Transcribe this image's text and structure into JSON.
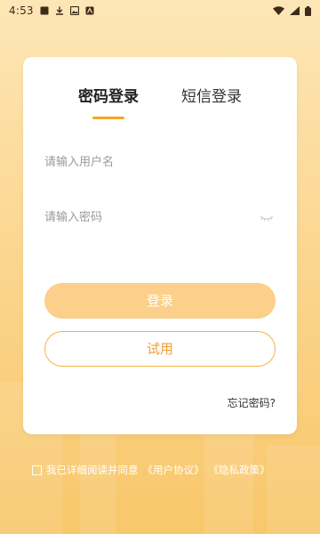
{
  "status_bar": {
    "time": "4:53",
    "icons": [
      "notification-square-icon",
      "download-icon",
      "photo-icon",
      "app-icon"
    ],
    "right_icons": [
      "wifi-icon",
      "signal-icon",
      "battery-icon"
    ]
  },
  "login": {
    "tabs": [
      {
        "label": "密码登录",
        "active": true
      },
      {
        "label": "短信登录",
        "active": false
      }
    ],
    "username_placeholder": "请输入用户名",
    "password_placeholder": "请输入密码",
    "login_button": "登录",
    "trial_button": "试用",
    "forgot_password": "忘记密码?"
  },
  "agreement": {
    "prefix": "我已详细阅读并同意",
    "user_agreement": "《用户协议》",
    "privacy_policy": "《隐私政策》"
  },
  "colors": {
    "accent": "#f5a623",
    "button_fill": "#fcd08a",
    "background_top": "#fde6b6",
    "background_bottom": "#f8c76a"
  }
}
